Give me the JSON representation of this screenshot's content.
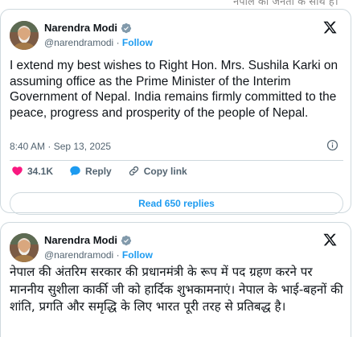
{
  "top_strip_text": "नेपाल की जनता के साथ है।",
  "tweets": [
    {
      "author_name": "Narendra Modi",
      "handle": "@narendramodi",
      "separator": "·",
      "follow_label": "Follow",
      "text": "I extend my best wishes to Right Hon. Mrs. Sushila Karki on assuming office as the Prime Minister of the Interim Government of Nepal. India remains firmly committed to the peace, progress and prosperity of the people of Nepal.",
      "timestamp": "8:40 AM · Sep 13, 2025",
      "likes": "34.1K",
      "reply_label": "Reply",
      "copy_link_label": "Copy link",
      "read_replies_label": "Read 650 replies"
    },
    {
      "author_name": "Narendra Modi",
      "handle": "@narendramodi",
      "separator": "·",
      "follow_label": "Follow",
      "text": "नेपाल की अंतरिम सरकार की प्रधानमंत्री के रूप में पद ग्रहण करने पर माननीय सुशीला कार्की जी को हार्दिक शुभकामनाएं। नेपाल के भाई-बहनों की शांति, प्रगति और समृद्धि के लिए भारत पूरी तरह से प्रतिबद्ध है।"
    }
  ],
  "colors": {
    "accent": "#1d9bf0",
    "like": "#f91880",
    "text": "#0f1419",
    "muted": "#536471",
    "border": "#cfd9de"
  },
  "icons": [
    "verified-badge-icon",
    "x-logo-icon",
    "info-icon",
    "heart-icon",
    "reply-bubble-icon",
    "link-icon"
  ]
}
